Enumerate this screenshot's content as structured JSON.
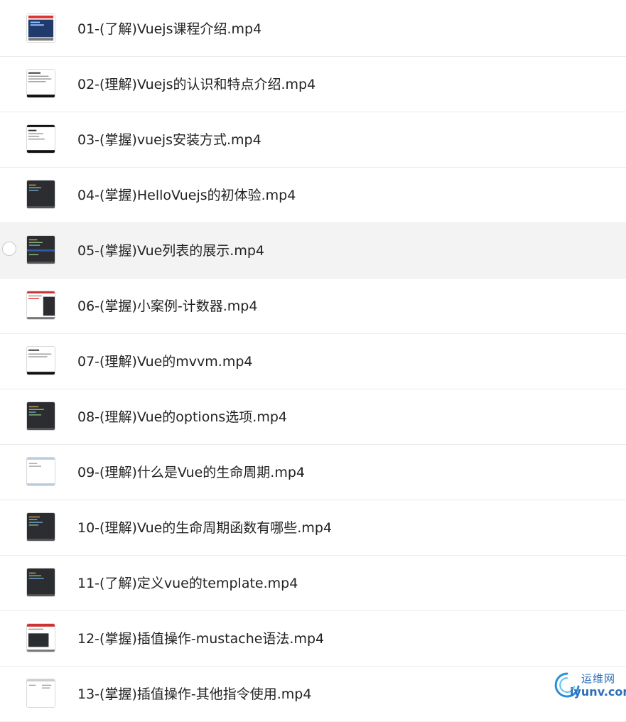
{
  "files": [
    {
      "name": "01-(了解)Vuejs课程介绍.mp4",
      "thumb": "thumb-light-screen"
    },
    {
      "name": "02-(理解)Vuejs的认识和特点介绍.mp4",
      "thumb": "thumb-document"
    },
    {
      "name": "03-(掌握)vuejs安装方式.mp4",
      "thumb": "thumb-document"
    },
    {
      "name": "04-(掌握)HelloVuejs的初体验.mp4",
      "thumb": "thumb-code-editor"
    },
    {
      "name": "05-(掌握)Vue列表的展示.mp4",
      "thumb": "thumb-code-editor"
    },
    {
      "name": "06-(掌握)小案例-计数器.mp4",
      "thumb": "thumb-browser-split"
    },
    {
      "name": "07-(理解)Vue的mvvm.mp4",
      "thumb": "thumb-document"
    },
    {
      "name": "08-(理解)Vue的options选项.mp4",
      "thumb": "thumb-code-editor"
    },
    {
      "name": "09-(理解)什么是Vue的生命周期.mp4",
      "thumb": "thumb-light-screen"
    },
    {
      "name": "10-(理解)Vue的生命周期函数有哪些.mp4",
      "thumb": "thumb-code-editor"
    },
    {
      "name": "11-(了解)定义vue的template.mp4",
      "thumb": "thumb-code-editor"
    },
    {
      "name": "12-(掌握)插值操作-mustache语法.mp4",
      "thumb": "thumb-browser-split"
    },
    {
      "name": "13-(掌握)插值操作-其他指令使用.mp4",
      "thumb": "thumb-light-screen"
    }
  ],
  "hovered_row": 4,
  "watermark": {
    "cn": "运维网",
    "en": "iyunv.com"
  },
  "colors": {
    "text": "#222222",
    "hover_bg": "#f3f3f3",
    "divider": "#ececec",
    "watermark": "#2a6ebb"
  }
}
